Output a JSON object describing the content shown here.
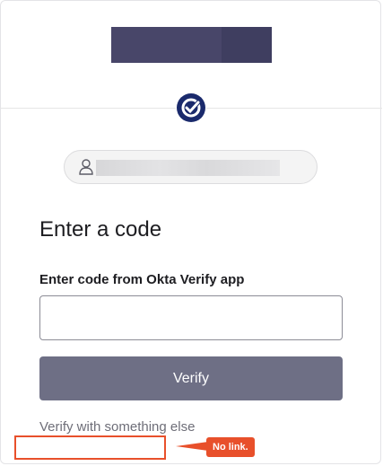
{
  "header": {
    "logo_alt": "redacted logo"
  },
  "factor": {
    "icon": "okta-verify-check-icon",
    "color": "#1a2a6c"
  },
  "user": {
    "icon": "user-icon"
  },
  "main": {
    "title": "Enter a code",
    "code_label": "Enter code from Okta Verify app",
    "code_value": "",
    "verify_label": "Verify",
    "alt_link": "Verify with something else"
  },
  "annotation": {
    "callout": "No link.",
    "color": "#e8502b"
  },
  "colors": {
    "button": "#6e6f85",
    "logo": "#484669"
  }
}
